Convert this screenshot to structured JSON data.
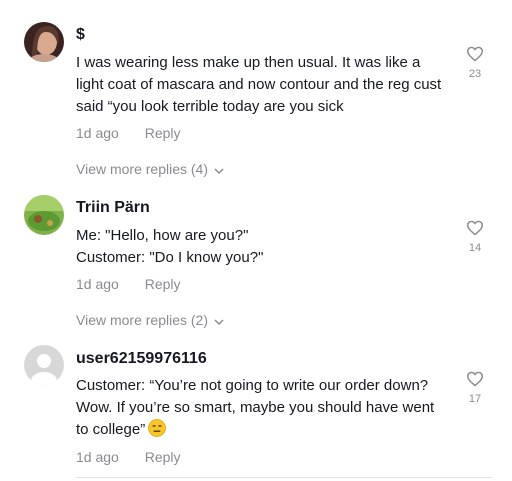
{
  "comments": [
    {
      "username": "$",
      "text": "I was wearing less make up then usual. It was like a light coat of mascara and now contour and the reg cust said “you look terrible today are you sick",
      "time": "1d ago",
      "reply_label": "Reply",
      "likes": "23",
      "view_more": "View more replies (4)"
    },
    {
      "username": "Triin Pärn",
      "line1": "Me: \"Hello, how are you?\"",
      "line2": "Customer: \"Do I know you?\"",
      "time": "1d ago",
      "reply_label": "Reply",
      "likes": "14",
      "view_more": "View more replies (2)"
    },
    {
      "username": "user62159976116",
      "text": "Customer: “You’re not going to write our order down? Wow. If you’re so smart, maybe you should have went to college”",
      "emoji": "expressionless-face-icon",
      "time": "1d ago",
      "reply_label": "Reply",
      "likes": "17"
    }
  ],
  "colors": {
    "text": "#161823",
    "muted": "#8a8b91",
    "divider": "#e3e3e4"
  }
}
